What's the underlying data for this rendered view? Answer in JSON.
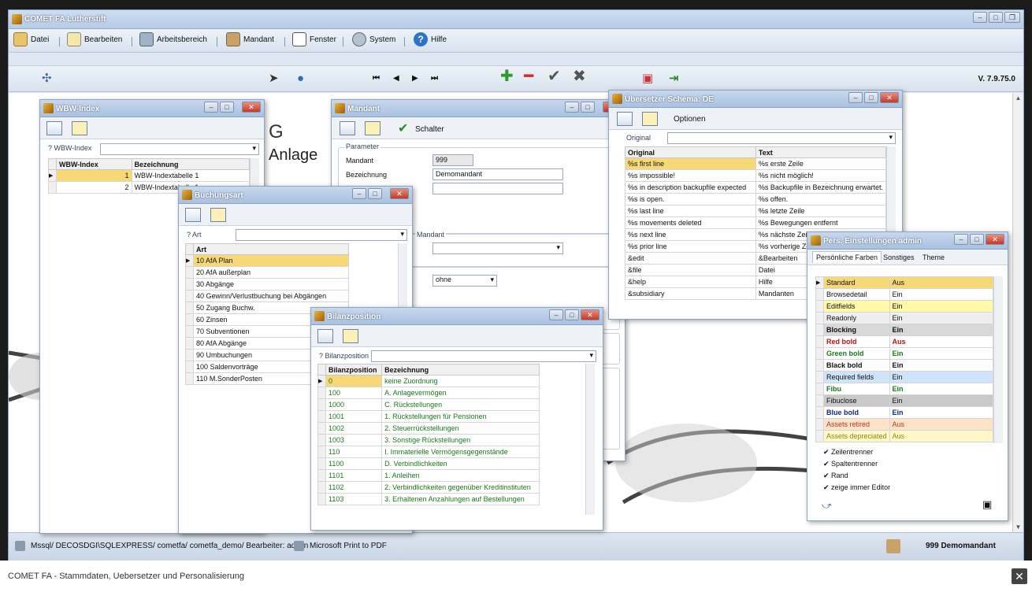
{
  "app": {
    "title": "COMET FA Lutherstift",
    "version": "V. 7.9.75.0"
  },
  "menu": [
    "Datei",
    "Bearbeiten",
    "Arbeitsbereich",
    "Mandant",
    "Fenster",
    "System",
    "Hilfe"
  ],
  "desktop": {
    "bg_text_1": "G",
    "bg_text_2": "Anlage"
  },
  "wbw": {
    "title": "WBW-Index",
    "filter_label": "? WBW-Index",
    "columns": [
      "WBW-Index",
      "Bezeichnung"
    ],
    "rows": [
      [
        "1",
        "WBW-Indextabelle 1"
      ],
      [
        "2",
        "WBW-Indextabelle 1"
      ]
    ]
  },
  "mandant": {
    "title": "Mandant",
    "tab_schalter": "Schalter",
    "group_parameter": "Parameter",
    "label_mandant": "Mandant",
    "value_mandant": "999",
    "label_bezeichnung": "Bezeichnung",
    "value_bezeichnung": "Demomandant",
    "group_mandant": "Mandant",
    "select_value": "ohne"
  },
  "schema": {
    "title": "Übersetzer Schema: DE",
    "tab_optionen": "Optionen",
    "filter_label": "Original",
    "columns": [
      "Original",
      "Text"
    ],
    "rows": [
      [
        "%s first line",
        "%s erste Zeile"
      ],
      [
        "%s impossible!",
        "%s nicht möglich!"
      ],
      [
        "%s in description backupfile expected",
        "%s Backupfile in Bezeichnung erwartet."
      ],
      [
        "%s is open.",
        "%s offen."
      ],
      [
        "%s last line",
        "%s letzte Zeile"
      ],
      [
        "%s movements deleted",
        "%s Bewegungen entfernt"
      ],
      [
        "%s next line",
        "%s nächste Zeile"
      ],
      [
        "%s prior line",
        "%s vorherige Zeile"
      ],
      [
        "&edit",
        "&Bearbeiten"
      ],
      [
        "&file",
        "Datei"
      ],
      [
        "&help",
        "Hilfe"
      ],
      [
        "&subsidiary",
        "Mandanten"
      ]
    ]
  },
  "buchungsart": {
    "title": "Buchungsart",
    "filter_label": "? Art",
    "column": "Art",
    "rows": [
      "10 AfA Plan",
      "20 AfA außerplan",
      "30 Abgänge",
      "40 Gewinn/Verlustbuchung bei Abgängen",
      "50 Zugang Buchw.",
      "60 Zinsen",
      "70 Subventionen",
      "80 AfA Abgänge",
      "90 Umbuchungen",
      "100 Saldenvorträge",
      "110 M.SonderPosten"
    ]
  },
  "bilanz": {
    "title": "Bilanzposition",
    "filter_label": "? Bilanzposition",
    "columns": [
      "Bilanzposition",
      "Bezeichnung"
    ],
    "rows": [
      [
        "0",
        "keine Zuordnung"
      ],
      [
        "100",
        "A. Anlagevermögen"
      ],
      [
        "1000",
        "C. Rückstellungen"
      ],
      [
        "1001",
        "1. Rückstellungen für Pensionen"
      ],
      [
        "1002",
        "2. Steuerrückstellungen"
      ],
      [
        "1003",
        "3. Sonstige Rückstellungen"
      ],
      [
        "110",
        "I. Immaterielle Vermögensgegenstände"
      ],
      [
        "1100",
        "D. Verbindlichkeiten"
      ],
      [
        "1101",
        "1. Anleihen"
      ],
      [
        "1102",
        "2. Verbindlichkeiten gegenüber Kreditinstituten"
      ],
      [
        "1103",
        "3. Erhaltenen Anzahlungen auf Bestellungen"
      ]
    ]
  },
  "pers": {
    "title": "Pers. Einstellungen admin",
    "tabs": [
      "Persönliche Farben",
      "Sonstiges",
      "Theme"
    ],
    "rows": [
      [
        "Standard",
        "Aus",
        "#f7d876",
        "#111",
        "normal"
      ],
      [
        "Browsedetail",
        "Ein",
        "#ffffff",
        "#111",
        "normal"
      ],
      [
        "Editfields",
        "Ein",
        "#fff9a8",
        "#111",
        "normal"
      ],
      [
        "Readonly",
        "Ein",
        "#eeeeee",
        "#111",
        "normal"
      ],
      [
        "Blocking",
        "Ein",
        "#d8d8d8",
        "#111",
        "bold"
      ],
      [
        "Red bold",
        "Aus",
        "#ffffff",
        "#c11111",
        "bold"
      ],
      [
        "Green bold",
        "Ein",
        "#ffffff",
        "#1a7a1a",
        "bold"
      ],
      [
        "Black bold",
        "Ein",
        "#ffffff",
        "#111",
        "bold"
      ],
      [
        "Required fields",
        "Ein",
        "#cfe3fa",
        "#111",
        "normal"
      ],
      [
        "Fibu",
        "Ein",
        "#ffffff",
        "#1a7a1a",
        "bold"
      ],
      [
        "Fibuclose",
        "Ein",
        "#c9c9c9",
        "#111",
        "normal"
      ],
      [
        "Blue bold",
        "Ein",
        "#ffffff",
        "#102a8a",
        "bold"
      ],
      [
        "Assets retired",
        "Aus",
        "#fde2c8",
        "#b33",
        "normal"
      ],
      [
        "Assets depreciated",
        "Aus",
        "#fff7c8",
        "#8a8a10",
        "normal"
      ]
    ],
    "checks": [
      "Zeilentrenner",
      "Spaltentrenner",
      "Rand",
      "zeige immer Editor"
    ]
  },
  "status": {
    "connection": "Mssql/ DECOSDGI\\SQLEXPRESS/ cometfa/ cometfa_demo/ Bearbeiter: admin",
    "printer": "Microsoft Print to PDF",
    "mandant": "999  Demomandant"
  },
  "caption": "COMET FA - Stammdaten, Uebersetzer und Personalisierung"
}
